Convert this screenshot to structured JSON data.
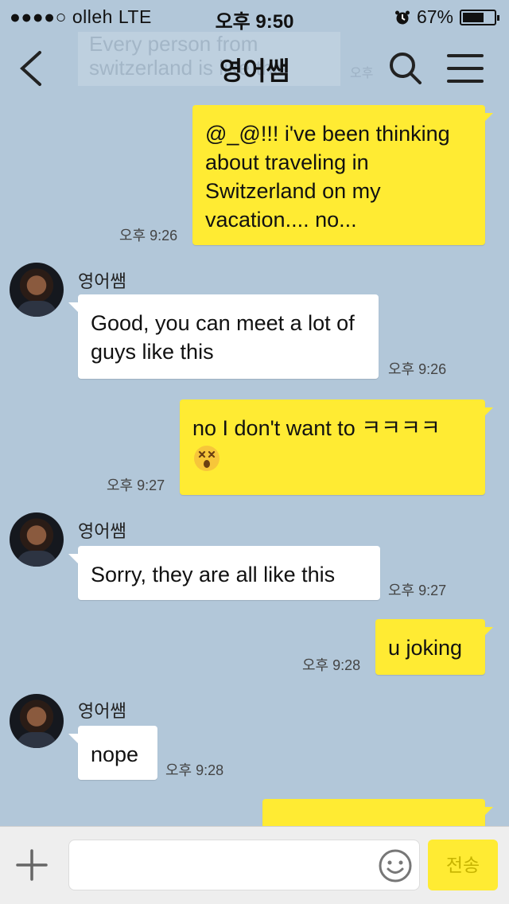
{
  "status_bar": {
    "carrier": "●●●●○ olleh   LTE",
    "time": "오후 9:50",
    "battery_percent": "67%",
    "battery_level": 0.67
  },
  "nav": {
    "title": "영어쌤",
    "ghost_text": "Every person from switzerland is like this"
  },
  "messages": [
    {
      "text": "@_@!!! i've been thinking about traveling in Switzerland on my vacation.... no...",
      "time": "오후 9:26"
    },
    {
      "sender": "영어쌤",
      "text": "Good, you can meet a lot of guys like this",
      "time": "오후 9:26"
    },
    {
      "text": "no I don't want to ㅋㅋㅋㅋ",
      "emoji": "dizzy-face-emoji",
      "time": "오후 9:27"
    },
    {
      "sender": "영어쌤",
      "text": "Sorry, they are all like this",
      "time": "오후 9:27"
    },
    {
      "text": "u joking",
      "time": "오후 9:28"
    },
    {
      "sender": "영어쌤",
      "text": "nope",
      "time": "오후 9:28"
    }
  ],
  "input": {
    "placeholder": "",
    "send_label": "전송"
  }
}
